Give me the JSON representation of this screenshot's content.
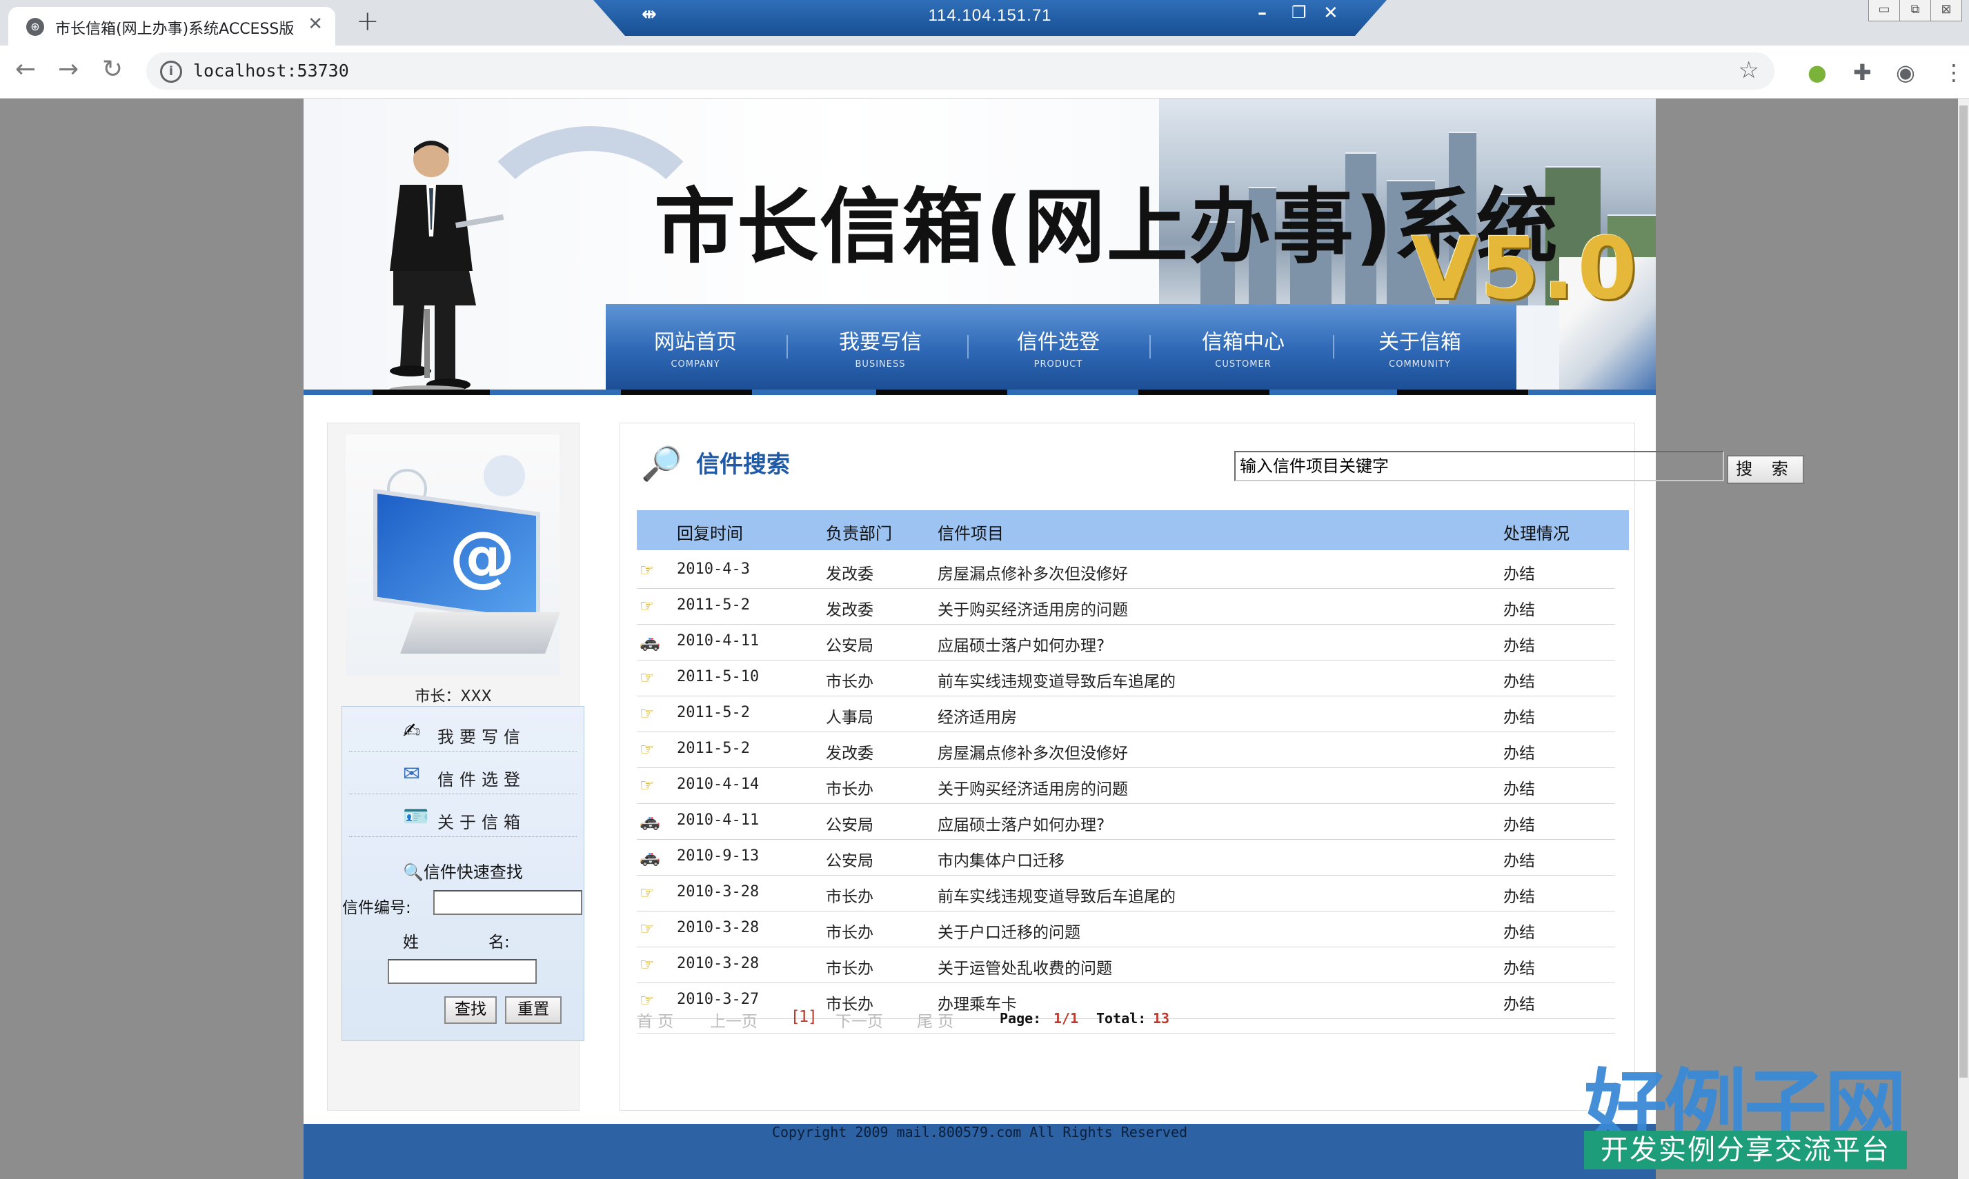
{
  "browser": {
    "tab_title": "市长信箱(网上办事)系统ACCESS版",
    "remote_title": "114.104.151.71",
    "url": "localhost:53730"
  },
  "site": {
    "title": "市长信箱(网上办事)系统",
    "version": "V5.0",
    "nav": [
      {
        "cn": "网站首页",
        "en": "COMPANY"
      },
      {
        "cn": "我要写信",
        "en": "BUSINESS"
      },
      {
        "cn": "信件选登",
        "en": "PRODUCT"
      },
      {
        "cn": "信箱中心",
        "en": "CUSTOMER"
      },
      {
        "cn": "关于信箱",
        "en": "COMMUNITY"
      }
    ]
  },
  "sidebar": {
    "mayor_label": "市长：XXX",
    "menu": [
      {
        "label": "我要写信",
        "icon": "write-letter-icon"
      },
      {
        "label": "信件选登",
        "icon": "envelope-icon"
      },
      {
        "label": "关于信箱",
        "icon": "id-card-icon"
      }
    ],
    "quick_search_title": "信件快速查找",
    "letter_no_label": "信件编号:",
    "name_label_1": "姓",
    "name_label_2": "名:",
    "find_btn": "查找",
    "reset_btn": "重置"
  },
  "search": {
    "title": "信件搜索",
    "input_value": "输入信件项目关键字",
    "button": "搜 索"
  },
  "table": {
    "headers": [
      "回复时间",
      "负责部门",
      "信件项目",
      "处理情况"
    ],
    "rows": [
      {
        "icon": "hand-pointer-icon",
        "date": "2010-4-3",
        "dept": "发改委",
        "item": "房屋漏点修补多次但没修好",
        "status": "办结"
      },
      {
        "icon": "hand-pointer-icon",
        "date": "2011-5-2",
        "dept": "发改委",
        "item": "关于购买经济适用房的问题",
        "status": "办结"
      },
      {
        "icon": "police-car-icon",
        "date": "2010-4-11",
        "dept": "公安局",
        "item": "应届硕士落户如何办理?",
        "status": "办结"
      },
      {
        "icon": "hand-pointer-icon",
        "date": "2011-5-10",
        "dept": "市长办",
        "item": "前车实线违规变道导致后车追尾的",
        "status": "办结"
      },
      {
        "icon": "hand-pointer-icon",
        "date": "2011-5-2",
        "dept": "人事局",
        "item": "经济适用房",
        "status": "办结"
      },
      {
        "icon": "hand-pointer-icon",
        "date": "2011-5-2",
        "dept": "发改委",
        "item": "房屋漏点修补多次但没修好",
        "status": "办结"
      },
      {
        "icon": "hand-pointer-icon",
        "date": "2010-4-14",
        "dept": "市长办",
        "item": "关于购买经济适用房的问题",
        "status": "办结"
      },
      {
        "icon": "police-car-icon",
        "date": "2010-4-11",
        "dept": "公安局",
        "item": "应届硕士落户如何办理?",
        "status": "办结"
      },
      {
        "icon": "police-car-icon",
        "date": "2010-9-13",
        "dept": "公安局",
        "item": "市内集体户口迁移",
        "status": "办结"
      },
      {
        "icon": "hand-pointer-icon",
        "date": "2010-3-28",
        "dept": "市长办",
        "item": "前车实线违规变道导致后车追尾的",
        "status": "办结"
      },
      {
        "icon": "hand-pointer-icon",
        "date": "2010-3-28",
        "dept": "市长办",
        "item": "关于户口迁移的问题",
        "status": "办结"
      },
      {
        "icon": "hand-pointer-icon",
        "date": "2010-3-28",
        "dept": "市长办",
        "item": "关于运管处乱收费的问题",
        "status": "办结"
      },
      {
        "icon": "hand-pointer-icon",
        "date": "2010-3-27",
        "dept": "市长办",
        "item": "办理乘车卡",
        "status": "办结"
      }
    ]
  },
  "pager": {
    "first": "首 页",
    "prev": "上一页",
    "current": "[1]",
    "next": "下一页",
    "last": "尾 页",
    "page_label": "Page:",
    "page_value": "1/1",
    "total_label": "Total:",
    "total_value": "13"
  },
  "footer": {
    "text": "Copyright 2009  mail.800579.com All Rights Reserved"
  },
  "watermark": {
    "logo": "好例子网",
    "tag": "开发实例分享交流平台"
  },
  "colors": {
    "nav_blue": "#2d67b5",
    "table_header": "#9cc3f2",
    "title_blue": "#1f5aa8",
    "version_gold": "#e5b83a",
    "footer_blue": "#2d62a5"
  }
}
